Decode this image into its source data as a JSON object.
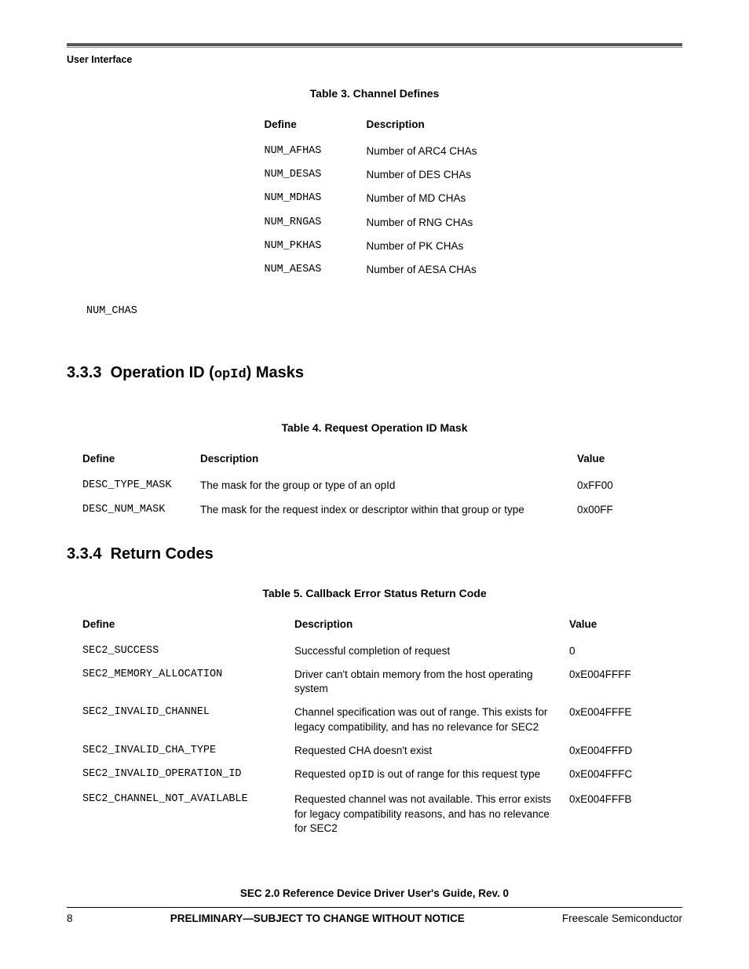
{
  "header": {
    "section": "User Interface"
  },
  "table3": {
    "caption": "Table 3. Channel Defines",
    "headers": [
      "Define",
      "Description"
    ],
    "rows": [
      {
        "define": "NUM_AFHAS",
        "desc": "Number of ARC4 CHAs"
      },
      {
        "define": "NUM_DESAS",
        "desc": "Number of DES CHAs"
      },
      {
        "define": "NUM_MDHAS",
        "desc": "Number of MD CHAs"
      },
      {
        "define": "NUM_RNGAS",
        "desc": "Number of RNG CHAs"
      },
      {
        "define": "NUM_PKHAS",
        "desc": "Number of PK CHAs"
      },
      {
        "define": "NUM_AESAS",
        "desc": "Number of AESA CHAs"
      }
    ]
  },
  "numchas": "NUM_CHAS",
  "section333": {
    "number": "3.3.3",
    "title_pre": "Operation ID (",
    "title_code": "opId",
    "title_post": ") Masks"
  },
  "table4": {
    "caption": "Table 4. Request Operation ID Mask",
    "headers": [
      "Define",
      "Description",
      "Value"
    ],
    "rows": [
      {
        "define": "DESC_TYPE_MASK",
        "desc": "The mask for the group or type of an opId",
        "value": "0xFF00"
      },
      {
        "define": "DESC_NUM_MASK",
        "desc": "The mask for the request index or descriptor within that group or type",
        "value": "0x00FF"
      }
    ]
  },
  "section334": {
    "number": "3.3.4",
    "title": "Return Codes"
  },
  "table5": {
    "caption": "Table 5. Callback Error Status Return Code",
    "headers": [
      "Define",
      "Description",
      "Value"
    ],
    "rows": [
      {
        "define": "SEC2_SUCCESS",
        "desc": "Successful completion of request",
        "value": "0"
      },
      {
        "define": "SEC2_MEMORY_ALLOCATION",
        "desc": "Driver can't obtain memory from the host operating system",
        "value": "0xE004FFFF"
      },
      {
        "define": "SEC2_INVALID_CHANNEL",
        "desc": "Channel specification was out of range. This exists for legacy compatibility, and has no relevance for SEC2",
        "value": "0xE004FFFE"
      },
      {
        "define": "SEC2_INVALID_CHA_TYPE",
        "desc": "Requested CHA doesn't exist",
        "value": "0xE004FFFD"
      },
      {
        "define": "SEC2_INVALID_OPERATION_ID",
        "desc_pre": "Requested ",
        "desc_code": "opID",
        "desc_post": " is out of range for this request type",
        "value": "0xE004FFFC"
      },
      {
        "define": "SEC2_CHANNEL_NOT_AVAILABLE",
        "desc": "Requested channel was not available. This error exists for legacy compatibility reasons, and has no relevance for SEC2",
        "value": "0xE004FFFB"
      }
    ]
  },
  "footer": {
    "doc_title": "SEC 2.0 Reference Device Driver User's Guide, Rev. 0",
    "page": "8",
    "center": "PRELIMINARY—SUBJECT TO CHANGE WITHOUT NOTICE",
    "right": "Freescale Semiconductor"
  }
}
